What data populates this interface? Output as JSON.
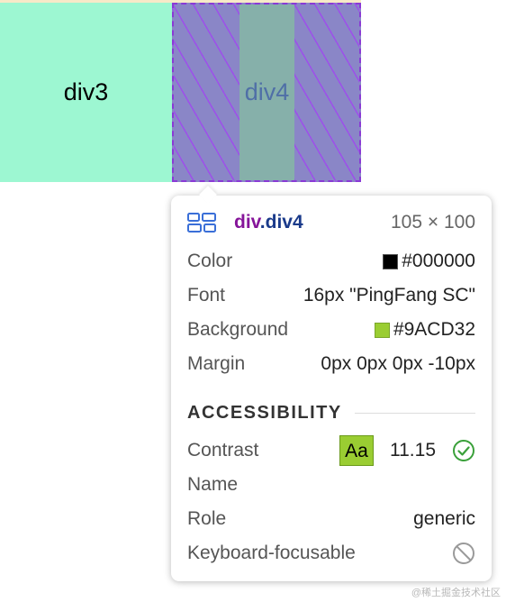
{
  "page": {
    "div3_label": "div3",
    "div4_label": "div4"
  },
  "tooltip": {
    "tag": "div",
    "class_name": ".div4",
    "dimensions": "105 × 100",
    "rows": [
      {
        "label": "Color",
        "value": "#000000",
        "swatch": "#000000"
      },
      {
        "label": "Font",
        "value": "16px \"PingFang SC\""
      },
      {
        "label": "Background",
        "value": "#9ACD32",
        "swatch": "#9acd32"
      },
      {
        "label": "Margin",
        "value": "0px 0px 0px -10px"
      }
    ],
    "accessibility": {
      "title": "ACCESSIBILITY",
      "contrast_label": "Contrast",
      "contrast_badge": "Aa",
      "contrast_value": "11.15",
      "contrast_icon": "check-circle-icon",
      "name_label": "Name",
      "role_label": "Role",
      "role_value": "generic",
      "keyboard_label": "Keyboard-focusable",
      "keyboard_icon": "not-allowed-icon"
    }
  },
  "watermark": "@稀土掘金技术社区",
  "colors": {
    "div3_bg": "#9df7d2",
    "div4_bg": "#8a86c7",
    "div4_content_bg": "#86b0aa",
    "accent_purple": "#86159a",
    "accent_navy": "#1a3a8a",
    "check_green": "#3aa03a"
  }
}
